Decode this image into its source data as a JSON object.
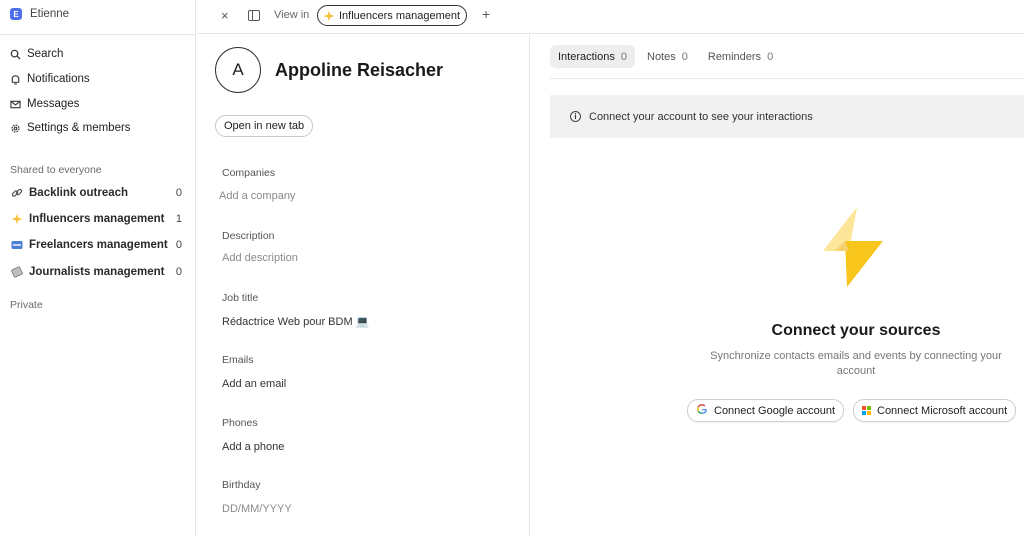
{
  "workspace": {
    "initial": "E",
    "name": "Etienne"
  },
  "nav": [
    {
      "label": "Search",
      "icon": "search-icon"
    },
    {
      "label": "Notifications",
      "icon": "bell-icon"
    },
    {
      "label": "Messages",
      "icon": "mail-icon"
    },
    {
      "label": "Settings & members",
      "icon": "gear-icon"
    }
  ],
  "shared": {
    "label": "Shared to everyone",
    "items": [
      {
        "label": "Backlink outreach",
        "count": "0",
        "icon": "link-icon"
      },
      {
        "label": "Influencers management",
        "count": "1",
        "icon": "sparkle-icon"
      },
      {
        "label": "Freelancers management",
        "count": "0",
        "icon": "free-badge-icon"
      },
      {
        "label": "Journalists management",
        "count": "0",
        "icon": "newspaper-icon"
      }
    ]
  },
  "private_label": "Private",
  "topbar": {
    "close": "×",
    "view_in": "View in",
    "chip_label": "Influencers management",
    "plus": "+"
  },
  "person": {
    "initial": "A",
    "name": "Appoline Reisacher",
    "open_tab": "Open in new tab",
    "fields": {
      "companies": {
        "label": "Companies",
        "value": "Add a company"
      },
      "description": {
        "label": "Description",
        "value": "Add description"
      },
      "job_title": {
        "label": "Job title",
        "value": "Rédactrice Web pour BDM 💻"
      },
      "emails": {
        "label": "Emails",
        "value": "Add an email"
      },
      "phones": {
        "label": "Phones",
        "value": "Add a phone"
      },
      "birthday": {
        "label": "Birthday",
        "value": "DD/MM/YYYY"
      }
    }
  },
  "tabs": [
    {
      "label": "Interactions",
      "count": "0"
    },
    {
      "label": "Notes",
      "count": "0"
    },
    {
      "label": "Reminders",
      "count": "0"
    }
  ],
  "banner": {
    "icon": "info-icon",
    "text": "Connect your account to see your interactions"
  },
  "connect": {
    "title": "Connect your sources",
    "subtitle": "Synchronize contacts emails and events by connecting your account",
    "google": "Connect Google account",
    "microsoft": "Connect Microsoft account"
  },
  "colors": {
    "accent": "#4f6fe8",
    "bolt_light": "#fde69a",
    "bolt_dark": "#f8c51c"
  }
}
